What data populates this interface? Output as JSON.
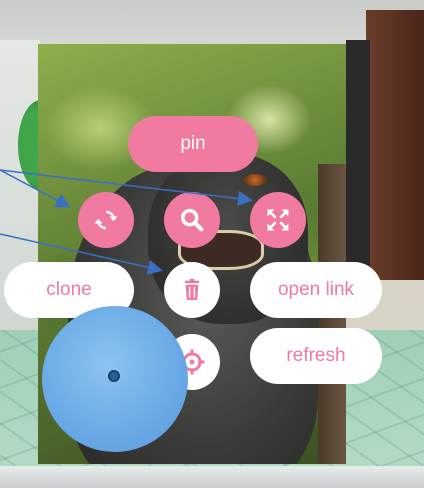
{
  "toolbar": {
    "pin_label": "pin",
    "clone_label": "clone",
    "open_link_label": "open link",
    "refresh_label": "refresh"
  },
  "icons": {
    "rotate": "rotate-icon",
    "zoom": "magnifier-icon",
    "expand": "expand-icon",
    "delete": "trash-icon",
    "focus": "crosshair-icon"
  },
  "colors": {
    "accent": "#f07aa0",
    "joystick": "#68a9e6",
    "arrow": "#3a6fc4"
  }
}
